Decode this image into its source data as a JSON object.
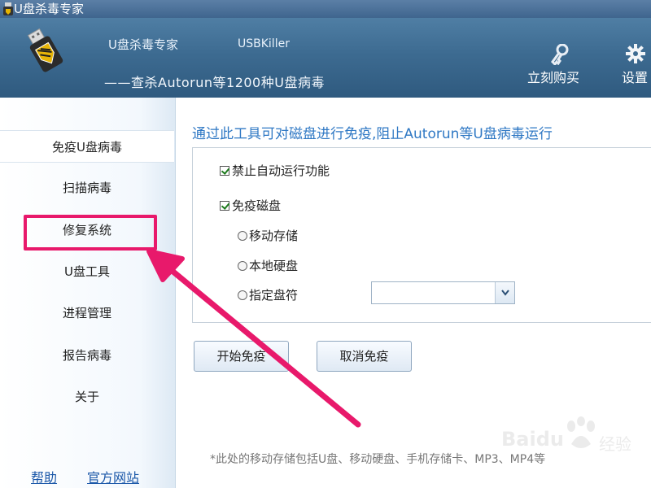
{
  "window": {
    "title": "U盘杀毒专家"
  },
  "header": {
    "app_name": "U盘杀毒专家",
    "english_name": "USBKiller",
    "slogan": "——查杀Autorun等1200种U盘病毒",
    "buy_label": "立刻购买",
    "settings_label": "设置"
  },
  "sidebar": {
    "items": [
      {
        "label": "免疫U盘病毒",
        "active": true
      },
      {
        "label": "扫描病毒",
        "active": false
      },
      {
        "label": "修复系统",
        "active": false
      },
      {
        "label": "U盘工具",
        "active": false
      },
      {
        "label": "进程管理",
        "active": false
      },
      {
        "label": "报告病毒",
        "active": false
      },
      {
        "label": "关于",
        "active": false
      }
    ],
    "footer_links": [
      "帮助",
      "官方网站"
    ]
  },
  "main": {
    "title": "通过此工具可对磁盘进行免疫,阻止Autorun等U盘病毒运行",
    "options": {
      "disable_autorun": {
        "label": "禁止自动运行功能",
        "checked": true
      },
      "immunize_disk": {
        "label": "免疫磁盘",
        "checked": true
      },
      "removable": {
        "label": "移动存储",
        "selected": false
      },
      "local_disk": {
        "label": "本地硬盘",
        "selected": false
      },
      "specify_drive": {
        "label": "指定盘符",
        "selected": false
      }
    },
    "drive_select_value": "",
    "start_button": "开始免疫",
    "cancel_button": "取消免疫",
    "note": "*此处的移动存储包括U盘、移动硬盘、手机存储卡、MP3、MP4等"
  },
  "annotation": {
    "highlight_color": "#e8196b",
    "target": "修复系统"
  },
  "watermark": {
    "text": "Baidu",
    "sub": "经验"
  },
  "colors": {
    "header": "#3d6b91",
    "accent": "#2f78c4",
    "link": "#1a57a8"
  }
}
